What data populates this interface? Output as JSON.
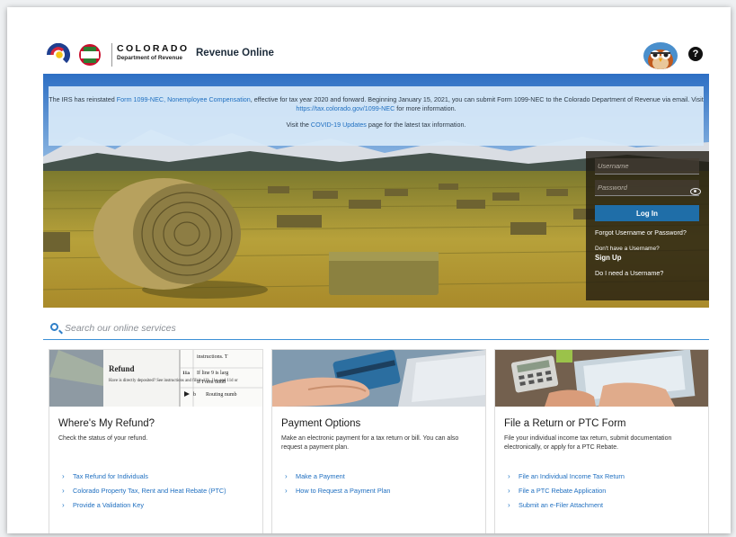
{
  "header": {
    "brand_state": "COLORADO",
    "brand_dept": "Department of Revenue",
    "app_title": "Revenue Online",
    "help_label": "?"
  },
  "alert": {
    "line1_pre": "The IRS has reinstated ",
    "line1_link": "Form 1099-NEC, Nonemployee Compensation",
    "line1_mid": ", effective for tax year 2020 and forward. Beginning January 15, 2021, you can submit Form 1099-NEC to the Colorado Department of Revenue via email. Visit ",
    "line1_link2": "https://tax.colorado.gov/1099-NEC",
    "line1_post": " for more information.",
    "line2_pre": "Visit the ",
    "line2_link": "COVID-19 Updates",
    "line2_post": " page for the latest tax information."
  },
  "login": {
    "username_placeholder": "Username",
    "password_placeholder": "Password",
    "login_button": "Log In",
    "forgot_link": "Forgot Username or Password?",
    "no_username_text": "Don't have a Username?",
    "signup_link": "Sign Up",
    "need_username_link": "Do I need a Username?"
  },
  "search": {
    "placeholder": "Search our online services"
  },
  "cards": [
    {
      "title": "Where's My Refund?",
      "description": "Check the status of your refund.",
      "links": [
        "Tax Refund for Individuals",
        "Colorado Property Tax, Rent and Heat Rebate (PTC)",
        "Provide a Validation Key"
      ],
      "image_text": {
        "heading": "Refund",
        "body": "Have is directly deposited? See instructions and fill in 11b, 11c, and 11d or",
        "col_instr": "instructions. T",
        "col_line": "11a",
        "col_line_text": "If line 9 is larg",
        "col_form": "If Form 8888",
        "col_b": "b",
        "col_routing": "Routing numb"
      }
    },
    {
      "title": "Payment Options",
      "description": "Make an electronic payment for a tax return or bill. You can also request a payment plan.",
      "links": [
        "Make a Payment",
        "How to Request a Payment Plan"
      ]
    },
    {
      "title": "File a Return or PTC Form",
      "description": "File your individual income tax return, submit documentation electronically, or apply for a PTC Rebate.",
      "links": [
        "File an Individual Income Tax Return",
        "File a PTC Rebate Application",
        "Submit an e-Filer Attachment"
      ]
    }
  ],
  "colors": {
    "accent": "#1f6fc0",
    "login_button": "#1f6ea8",
    "alert_bg": "#d6e8f8"
  }
}
